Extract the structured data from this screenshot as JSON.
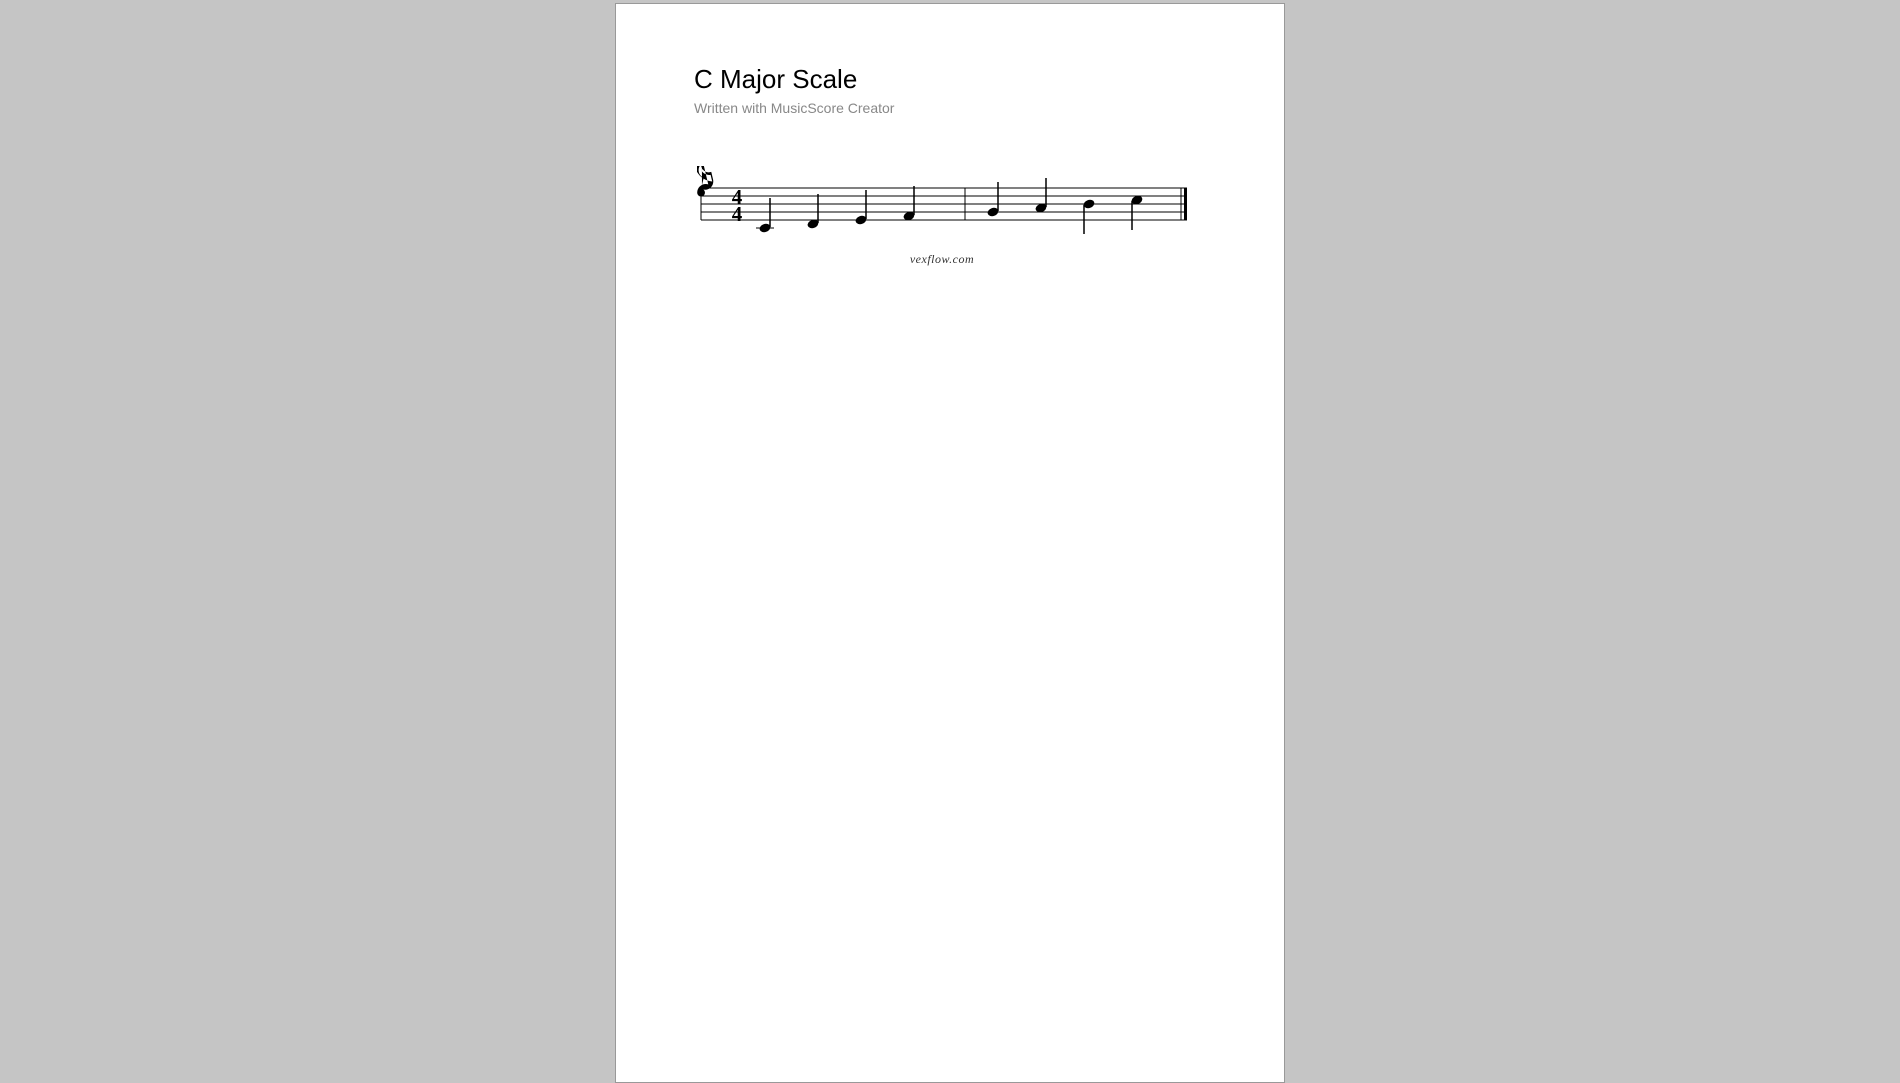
{
  "title": "C Major Scale",
  "subtitle": "Written with MusicScore Creator",
  "watermark": "vexflow.com",
  "score": {
    "clef": "treble",
    "time_signature": {
      "numerator": 4,
      "denominator": 4
    },
    "measures": [
      {
        "notes": [
          "C4",
          "D4",
          "E4",
          "F4"
        ],
        "duration": "quarter"
      },
      {
        "notes": [
          "G4",
          "A4",
          "B4",
          "C5"
        ],
        "duration": "quarter"
      }
    ],
    "final_barline": true
  }
}
